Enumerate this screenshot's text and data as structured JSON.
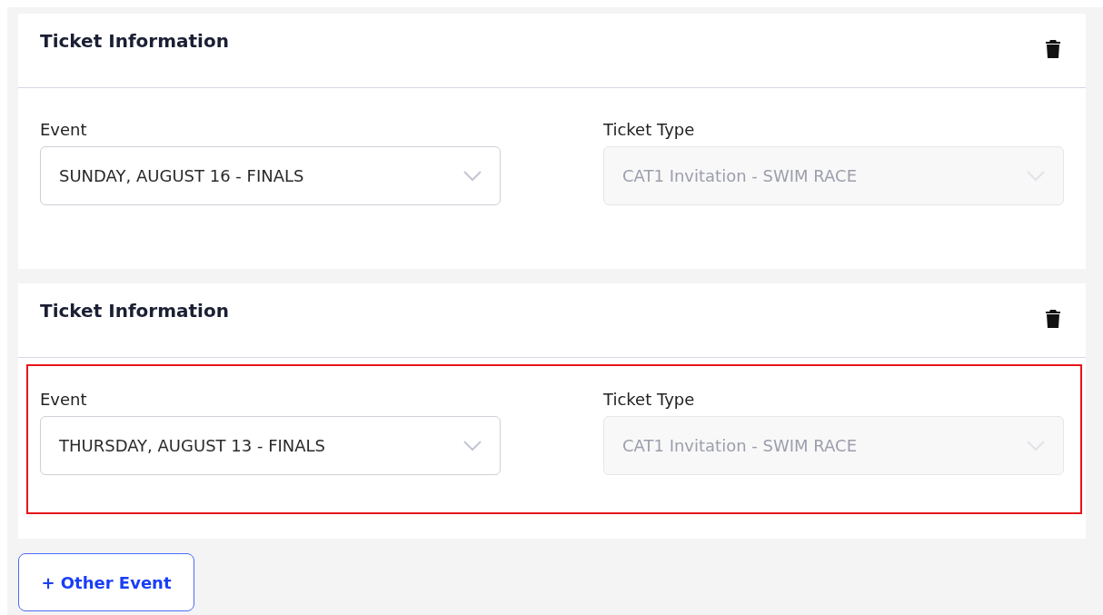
{
  "cards": [
    {
      "title": "Ticket Information",
      "highlighted": false,
      "fields": [
        {
          "label": "Event",
          "value": "SUNDAY, AUGUST 16 - FINALS",
          "disabled": false
        },
        {
          "label": "Ticket Type",
          "value": "CAT1 Invitation - SWIM RACE",
          "disabled": true
        }
      ]
    },
    {
      "title": "Ticket Information",
      "highlighted": true,
      "fields": [
        {
          "label": "Event",
          "value": "THURSDAY, AUGUST 13 - FINALS",
          "disabled": false
        },
        {
          "label": "Ticket Type",
          "value": "CAT1 Invitation - SWIM RACE",
          "disabled": true
        }
      ]
    }
  ],
  "add_button": "+ Other Event"
}
